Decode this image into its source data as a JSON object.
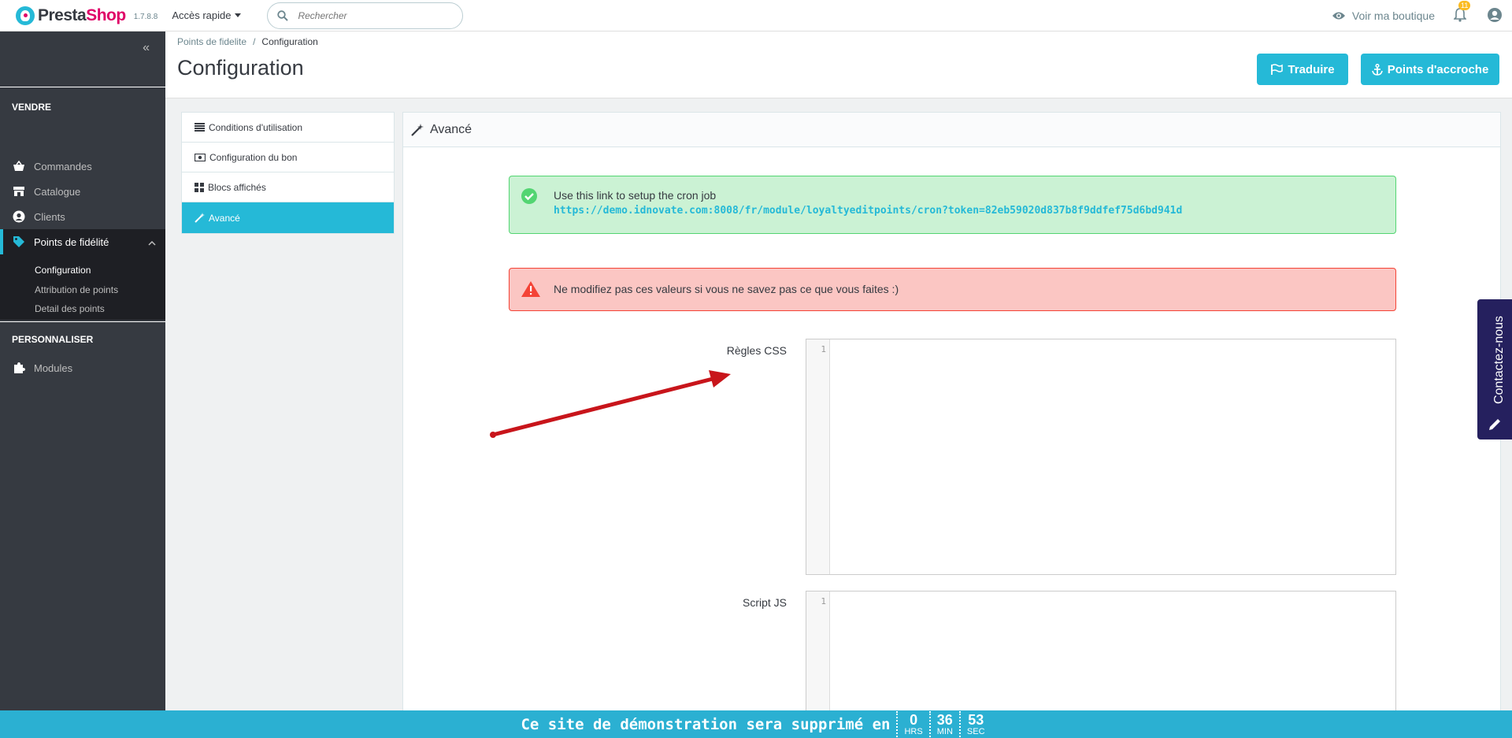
{
  "header": {
    "logo_presta": "Presta",
    "logo_shop": "Shop",
    "version": "1.7.8.8",
    "quick_access": "Accès rapide",
    "search_placeholder": "Rechercher",
    "view_shop": "Voir ma boutique",
    "notifications_count": "11"
  },
  "sidebar": {
    "sell_title": "VENDRE",
    "items": [
      {
        "label": "Commandes",
        "icon": "basket-icon"
      },
      {
        "label": "Catalogue",
        "icon": "store-icon"
      },
      {
        "label": "Clients",
        "icon": "user-circle-icon"
      },
      {
        "label": "Points de fidélité",
        "icon": "tag-icon"
      }
    ],
    "sub_items": [
      {
        "label": "Configuration"
      },
      {
        "label": "Attribution de points"
      },
      {
        "label": "Detail des points"
      }
    ],
    "customize_title": "PERSONNALISER",
    "modules_label": "Modules"
  },
  "page": {
    "breadcrumb_parent": "Points de fidelite",
    "breadcrumb_sep": "/",
    "breadcrumb_current": "Configuration",
    "title": "Configuration",
    "translate_btn": "Traduire",
    "hooks_btn": "Points d'accroche"
  },
  "tabs": [
    {
      "label": "Conditions d'utilisation",
      "icon": "list-icon"
    },
    {
      "label": "Configuration du bon",
      "icon": "money-icon"
    },
    {
      "label": "Blocs affichés",
      "icon": "grid-icon"
    },
    {
      "label": "Avancé",
      "icon": "magic-wand-icon"
    }
  ],
  "panel": {
    "heading": "Avancé",
    "success_line1": "Use this link to setup the cron job",
    "success_link": "https://demo.idnovate.com:8008/fr/module/loyaltyeditpoints/cron?token=82eb59020d837b8f9ddfef75d6bd941d",
    "danger_text": "Ne modifiez pas ces valeurs si vous ne savez pas ce que vous faites :)",
    "css_label": "Règles CSS",
    "js_label": "Script JS",
    "line_number": "1"
  },
  "contact": {
    "label": "Contactez-nous"
  },
  "demo_banner": {
    "text": "Ce site de démonstration sera supprimé en",
    "hours": "0",
    "hours_unit": "HRS",
    "minutes": "36",
    "minutes_unit": "MIN",
    "seconds": "53",
    "seconds_unit": "SEC"
  },
  "colors": {
    "accent": "#25b9d7",
    "sidebar_bg": "#363a41",
    "success_bg": "#cbf2d4",
    "danger_bg": "#fbc6c3",
    "brand_pink": "#df0067",
    "contact_bg": "#25205e"
  }
}
